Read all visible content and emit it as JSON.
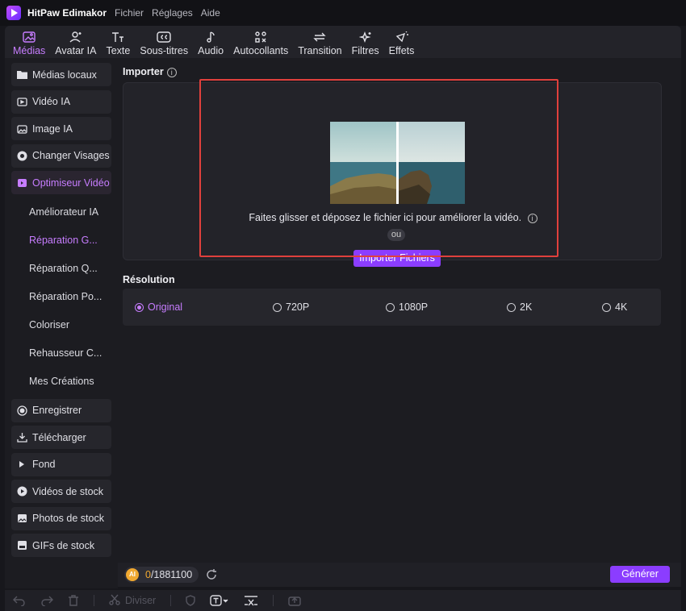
{
  "app": {
    "name": "HitPaw Edimakor",
    "menu": [
      "Fichier",
      "Réglages",
      "Aide"
    ]
  },
  "toolbar": {
    "tabs": [
      {
        "label": "Médias",
        "icon": "media-icon",
        "active": true
      },
      {
        "label": "Avatar IA",
        "icon": "avatar-icon"
      },
      {
        "label": "Texte",
        "icon": "text-icon"
      },
      {
        "label": "Sous-titres",
        "icon": "subtitles-icon"
      },
      {
        "label": "Audio",
        "icon": "audio-icon"
      },
      {
        "label": "Autocollants",
        "icon": "stickers-icon"
      },
      {
        "label": "Transition",
        "icon": "transition-icon"
      },
      {
        "label": "Filtres",
        "icon": "filters-icon"
      },
      {
        "label": "Effets",
        "icon": "effects-icon"
      }
    ]
  },
  "sidebar": {
    "items_top": [
      {
        "label": "Médias locaux",
        "icon": "folder-icon"
      },
      {
        "label": "Vidéo IA",
        "icon": "ai-video-icon"
      },
      {
        "label": "Image IA",
        "icon": "ai-image-icon"
      },
      {
        "label": "Changer Visages",
        "icon": "face-swap-icon"
      },
      {
        "label": "Optimiseur Vidéo",
        "icon": "video-enhancer-icon",
        "active": true
      }
    ],
    "sub_items": [
      {
        "label": "Améliorateur IA"
      },
      {
        "label": "Réparation G...",
        "active": true
      },
      {
        "label": "Réparation Q..."
      },
      {
        "label": "Réparation Po..."
      },
      {
        "label": "Coloriser"
      },
      {
        "label": "Rehausseur C..."
      },
      {
        "label": "Mes Créations"
      }
    ],
    "items_bottom": [
      {
        "label": "Enregistrer",
        "icon": "record-icon"
      },
      {
        "label": "Télécharger",
        "icon": "download-icon"
      },
      {
        "label": "Fond",
        "icon": "play-triangle-icon"
      },
      {
        "label": "Vidéos de stock",
        "icon": "stock-video-icon"
      },
      {
        "label": "Photos de stock",
        "icon": "stock-photo-icon"
      },
      {
        "label": "GIFs de stock",
        "icon": "gif-icon"
      }
    ]
  },
  "importer": {
    "title": "Importer",
    "info": "i",
    "drop_text": "Faites glisser et déposez le fichier ici pour améliorer la vidéo.",
    "or_text": "ou",
    "button": "Importer Fichiers"
  },
  "resolution": {
    "title": "Résolution",
    "options": [
      {
        "label": "Original",
        "selected": true
      },
      {
        "label": "720P"
      },
      {
        "label": "1080P"
      },
      {
        "label": "2K"
      },
      {
        "label": "4K"
      }
    ]
  },
  "credits": {
    "used": "0",
    "total": "/1881100",
    "coin": "AI"
  },
  "generate": {
    "label": "Générer"
  },
  "timeline": {
    "split_label": "Diviser"
  },
  "colors": {
    "accent": "#8b3dff",
    "accent_text": "#c77dff",
    "highlight_border": "#e0403c"
  }
}
